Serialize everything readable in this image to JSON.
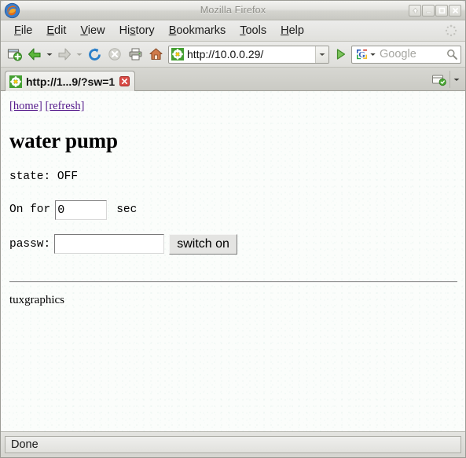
{
  "window": {
    "title": "Mozilla Firefox",
    "logo_icon": "firefox-logo-icon",
    "controls": [
      {
        "name": "shade-button",
        "icon": "arrow-up-icon"
      },
      {
        "name": "minimize-button",
        "icon": "minimize-icon"
      },
      {
        "name": "maximize-button",
        "icon": "maximize-icon"
      },
      {
        "name": "close-button",
        "icon": "close-icon"
      }
    ]
  },
  "menubar": {
    "items": [
      {
        "pre": "",
        "key": "F",
        "post": "ile"
      },
      {
        "pre": "",
        "key": "E",
        "post": "dit"
      },
      {
        "pre": "",
        "key": "V",
        "post": "iew"
      },
      {
        "pre": "Hi",
        "key": "s",
        "post": "tory"
      },
      {
        "pre": "",
        "key": "B",
        "post": "ookmarks"
      },
      {
        "pre": "",
        "key": "T",
        "post": "ools"
      },
      {
        "pre": "",
        "key": "H",
        "post": "elp"
      }
    ],
    "throbber_icon": "throbber-idle-icon"
  },
  "toolbar": {
    "new_tab_icon": "new-tab-icon",
    "back_icon": "back-arrow-icon",
    "back_dropdown_icon": "chevron-down-icon",
    "forward_icon": "forward-arrow-icon",
    "forward_dropdown_icon": "chevron-down-icon",
    "reload_icon": "reload-icon",
    "stop_icon": "stop-icon",
    "print_icon": "print-icon",
    "home_icon": "home-icon",
    "go_icon": "go-arrow-icon"
  },
  "urlbar": {
    "favicon": "page-favicon-flower-icon",
    "value": "http://10.0.0.29/",
    "placeholder": "",
    "dropdown_icon": "chevron-down-icon"
  },
  "searchbar": {
    "engine_icon": "google-g-icon",
    "engine_dropdown_icon": "chevron-down-icon",
    "placeholder": "Google",
    "magnifier_icon": "search-magnifier-icon"
  },
  "tabbar": {
    "tab": {
      "favicon": "page-favicon-flower-icon",
      "title": "http://1...9/?sw=1",
      "close_icon": "tab-close-icon"
    },
    "list_all_tabs_icon": "list-all-tabs-icon",
    "alltabs_dropdown_icon": "chevron-down-icon"
  },
  "page": {
    "links": [
      {
        "label": "[home]"
      },
      {
        "label": "[refresh]"
      }
    ],
    "heading": "water pump",
    "state_line": "state: OFF",
    "onfor_label": "On for",
    "seconds_value": "0",
    "seconds_placeholder": "",
    "sec_label": "sec",
    "passw_label": "passw:",
    "passw_value": "",
    "passw_placeholder": "",
    "switch_button": "switch on",
    "footer": "tuxgraphics"
  },
  "statusbar": {
    "text": "Done"
  },
  "colors": {
    "link": "#551a8b",
    "chrome": "#dededa",
    "page_bg": "#fbfdfb",
    "accent_green": "#3a9e28"
  }
}
